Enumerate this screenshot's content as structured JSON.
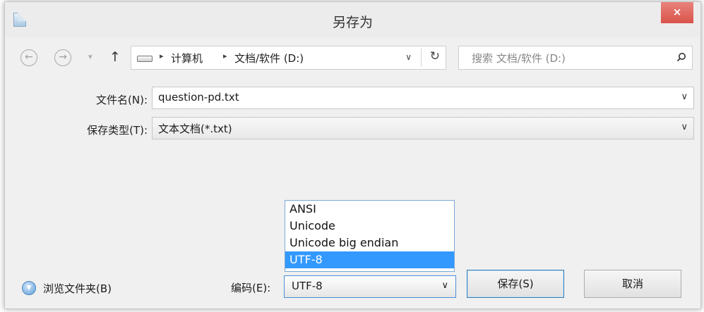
{
  "window": {
    "title": "另存为",
    "close_glyph": "×"
  },
  "nav": {
    "back_glyph": "←",
    "forward_glyph": "→",
    "dropdown_glyph": "▾",
    "up_glyph": "↑",
    "breadcrumb": [
      "计算机",
      "文档/软件 (D:)"
    ],
    "refresh_glyph": "↻",
    "search_placeholder": "搜索 文档/软件 (D:)"
  },
  "form": {
    "filename_label": "文件名(N):",
    "filename_value": "question-pd.txt",
    "filetype_label": "保存类型(T):",
    "filetype_value": "文本文档(*.txt)"
  },
  "footer": {
    "browse_label": "浏览文件夹(B)",
    "encoding_label": "编码(E):",
    "encoding_value": "UTF-8",
    "encoding_options": [
      "ANSI",
      "Unicode",
      "Unicode big endian",
      "UTF-8"
    ],
    "encoding_selected_index": 3,
    "save_button": "保存(S)",
    "cancel_button": "取消"
  },
  "colors": {
    "selection": "#3399ff",
    "close_button": "#d9534a",
    "focus_border": "#4a8fd6"
  },
  "icons": [
    "app-icon",
    "back-icon",
    "forward-icon",
    "up-arrow-icon",
    "drive-icon",
    "refresh-icon",
    "search-icon",
    "browse-folders-icon"
  ]
}
